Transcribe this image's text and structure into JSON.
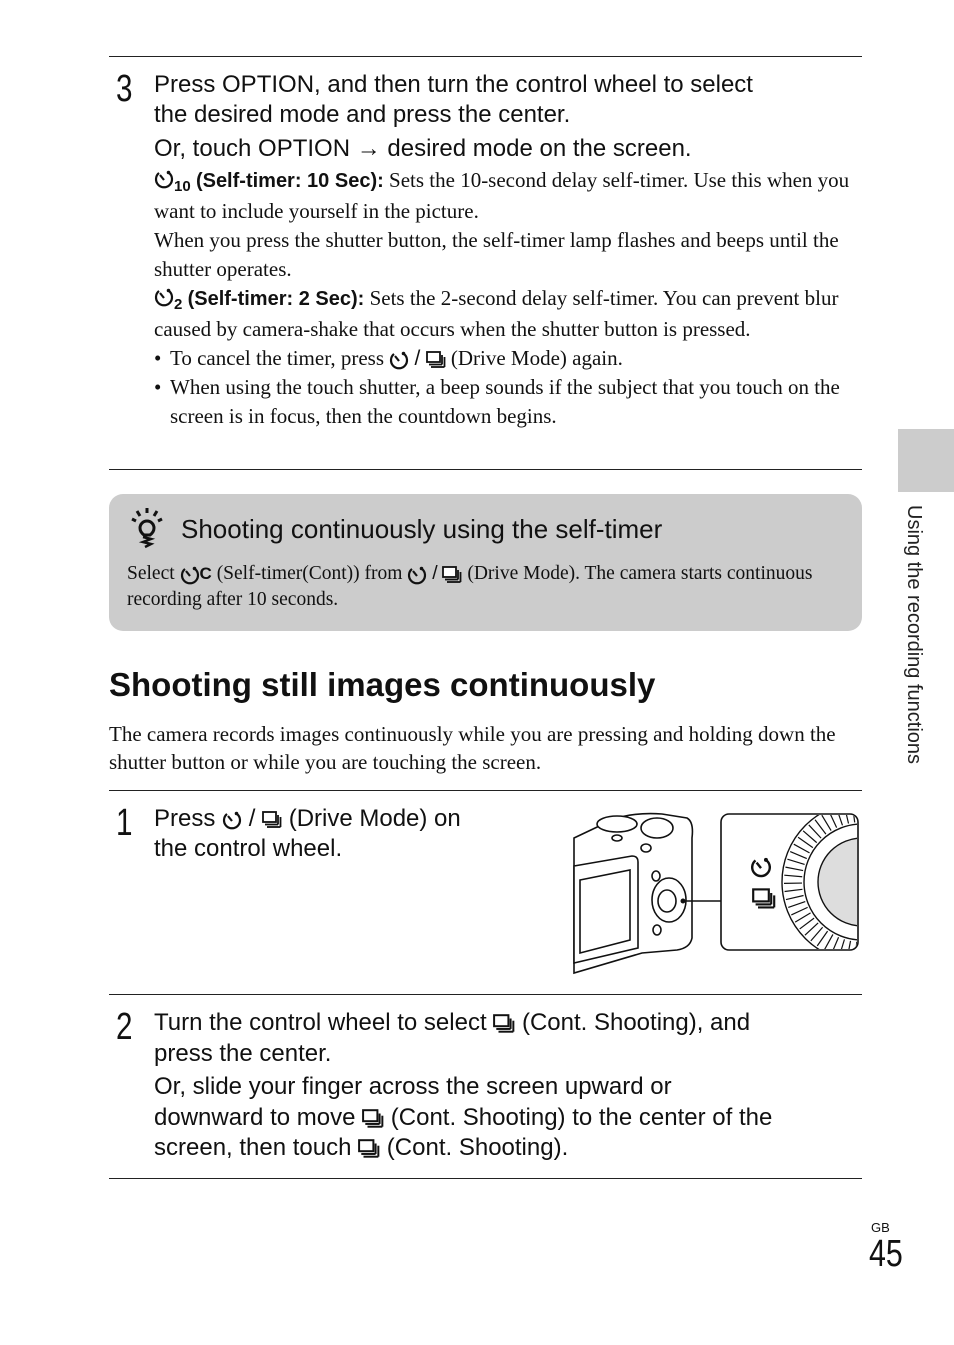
{
  "step3": {
    "number": "3",
    "line1": "Press OPTION, and then turn the control wheel to select",
    "line2": "the desired mode and press the center.",
    "line3_prefix": "Or, touch OPTION ",
    "arrow": "→",
    "line3_suffix": " desired mode on the screen.",
    "timer10": {
      "icon": "self-timer-icon",
      "subscript": "10",
      "label": "(Self-timer: 10 Sec):",
      "text": " Sets the 10-second delay self-timer. Use this when you want to include yourself in the picture."
    },
    "timer10_extra": "When you press the shutter button, the self-timer lamp flashes and beeps until the shutter operates.",
    "timer2": {
      "icon": "self-timer-icon",
      "subscript": "2",
      "label": "(Self-timer: 2 Sec):",
      "text": " Sets the 2-second delay self-timer. You can prevent blur caused by camera-shake that occurs when the shutter button is pressed."
    },
    "bullets": [
      {
        "prefix": "To cancel the timer, press ",
        "suffix": " (Drive Mode) again."
      },
      {
        "prefix": "When using the touch shutter, a beep sounds if the subject that you touch on the screen is in focus, then the countdown begins.",
        "suffix": ""
      }
    ]
  },
  "tip": {
    "icon": "hint-lightbulb-icon",
    "title": "Shooting continuously using the self-timer",
    "body_1": "Select ",
    "body_2": " (Self-timer(Cont)) from ",
    "body_3": " (Drive Mode). The camera starts continuous recording after 10 seconds."
  },
  "section": {
    "heading": "Shooting still images continuously",
    "intro": "The camera records images continuously while you are pressing and holding down the shutter button or while you are touching the screen."
  },
  "step1": {
    "number": "1",
    "prefix": "Press ",
    "suffix": " (Drive Mode) on",
    "line2": "the control wheel."
  },
  "step2": {
    "number": "2",
    "line1_prefix": "Turn the control wheel to select ",
    "line1_suffix": " (Cont. Shooting), and",
    "line2": "press the center.",
    "line3": "Or, slide your finger across the screen upward or",
    "line4_prefix": "downward to move ",
    "line4_suffix": " (Cont. Shooting) to the center of the",
    "line5_prefix": "screen, then touch ",
    "line5_suffix": " (Cont. Shooting)."
  },
  "sidebar": {
    "label": "Using the recording functions"
  },
  "footer": {
    "region": "GB",
    "page": "45"
  },
  "colors": {
    "tip_background": "#cccccc",
    "side_tab": "#cccccc",
    "text": "#111111"
  }
}
